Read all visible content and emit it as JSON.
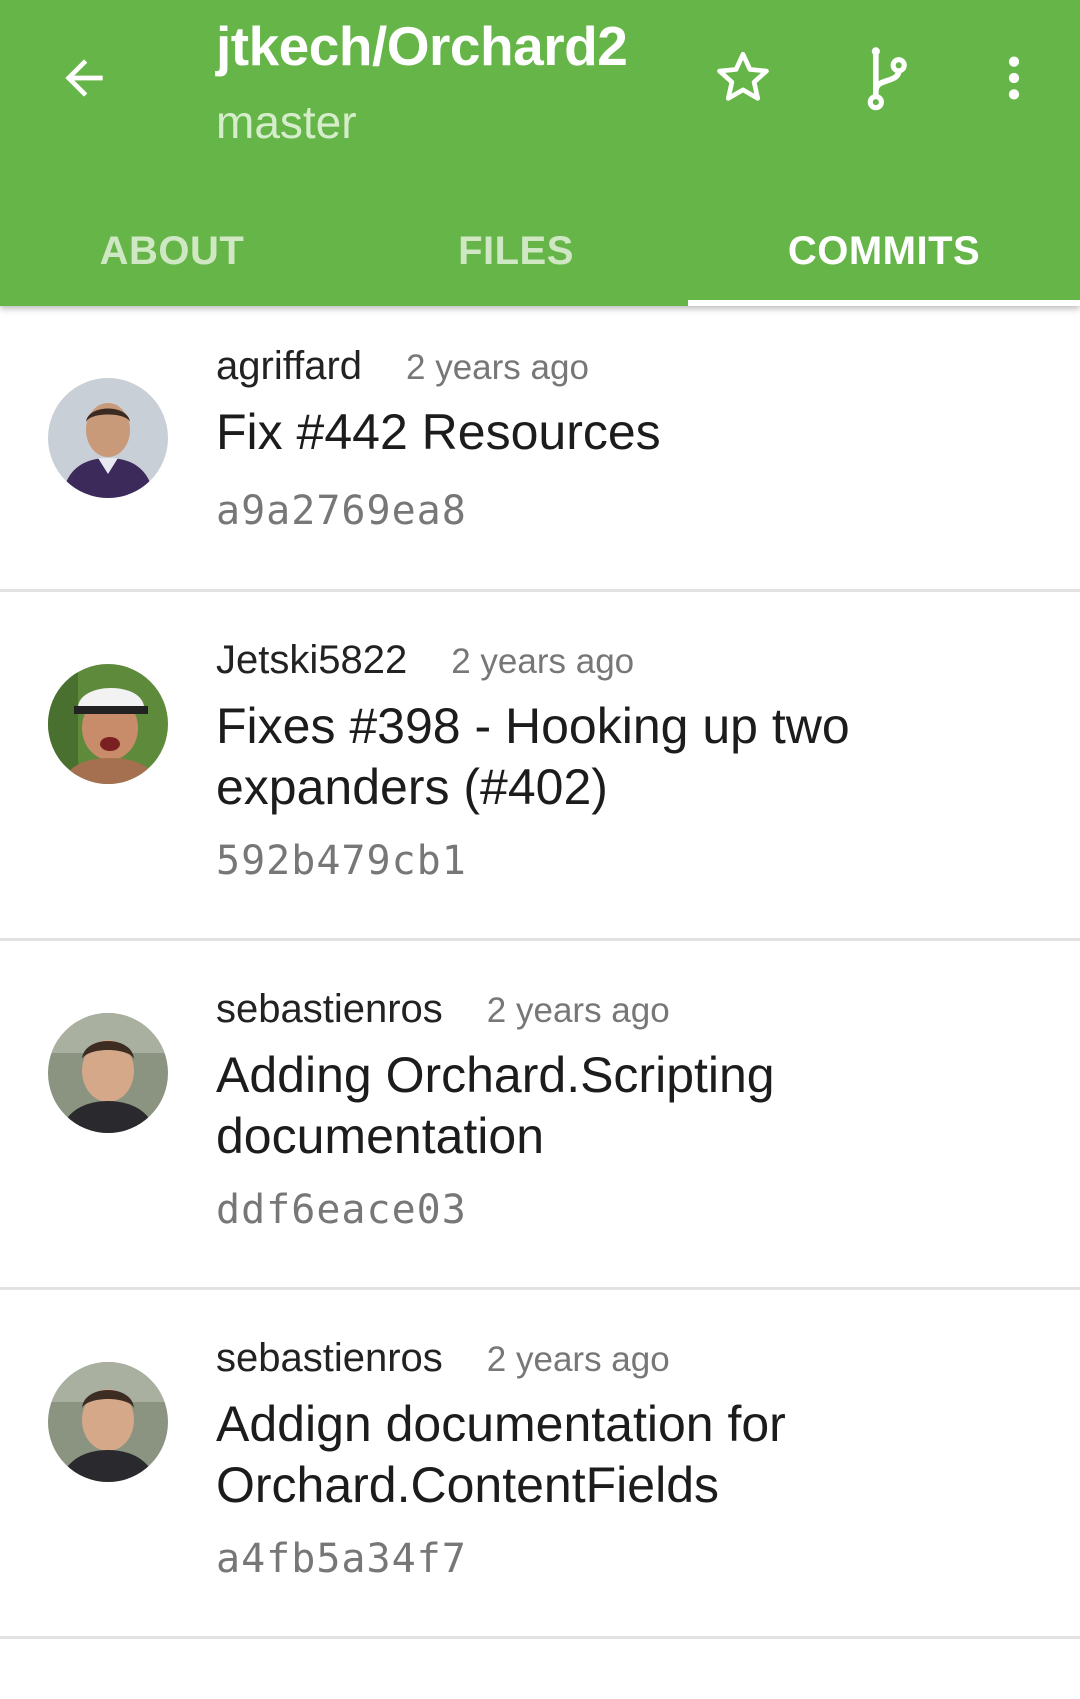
{
  "app": {
    "repo_title": "jtkech/Orchard2",
    "branch": "master",
    "icons": {
      "back": "arrow-left-icon",
      "star": "star-outline-icon",
      "branch": "git-branch-icon",
      "more": "more-vertical-icon"
    },
    "colors": {
      "primary": "#66b548",
      "tab_inactive": "#cfe8c3",
      "text_secondary": "#777777"
    }
  },
  "tabs": [
    {
      "label": "ABOUT",
      "active": false
    },
    {
      "label": "FILES",
      "active": false
    },
    {
      "label": "COMMITS",
      "active": true
    }
  ],
  "commits": [
    {
      "author": "agriffard",
      "time": "2 years ago",
      "message": "Fix #442 Resources",
      "sha": "a9a2769ea8",
      "avatar": "avatar-agriffard"
    },
    {
      "author": "Jetski5822",
      "time": "2 years ago",
      "message": "Fixes #398 - Hooking up two expanders (#402)",
      "sha": "592b479cb1",
      "avatar": "avatar-jetski5822"
    },
    {
      "author": "sebastienros",
      "time": "2 years ago",
      "message": "Adding Orchard.Scripting documentation",
      "sha": "ddf6eace03",
      "avatar": "avatar-sebastienros"
    },
    {
      "author": "sebastienros",
      "time": "2 years ago",
      "message": "Addign documentation for Orchard.ContentFields",
      "sha": "a4fb5a34f7",
      "avatar": "avatar-sebastienros"
    }
  ]
}
